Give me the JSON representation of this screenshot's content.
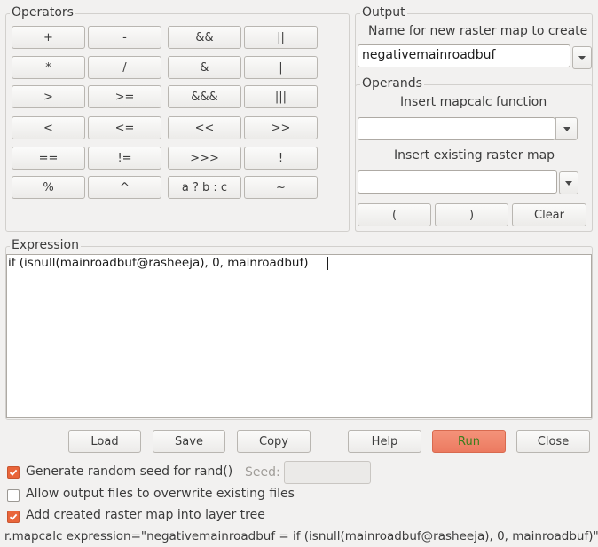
{
  "operators": {
    "title": "Operators",
    "rows": [
      [
        "+",
        "-",
        "&&",
        "||"
      ],
      [
        "*",
        "/",
        "&",
        "|"
      ],
      [
        ">",
        ">=",
        "&&&",
        "|||"
      ],
      [
        "<",
        "<=",
        "<<",
        ">>"
      ],
      [
        "==",
        "!=",
        ">>>",
        "!"
      ],
      [
        "%",
        "^",
        "a ? b : c",
        "~"
      ]
    ]
  },
  "output": {
    "title": "Output",
    "name_label": "Name for new raster map to create",
    "name_value": "negativemainroadbuf"
  },
  "operands": {
    "title": "Operands",
    "function_label": "Insert mapcalc function",
    "function_value": "",
    "raster_label": "Insert existing raster map",
    "raster_value": "",
    "open_paren": "(",
    "close_paren": ")",
    "clear_label": "Clear"
  },
  "expression": {
    "title": "Expression",
    "text": "if (isnull(mainroadbuf@rasheeja), 0, mainroadbuf)"
  },
  "actions": {
    "load": "Load",
    "save": "Save",
    "copy": "Copy",
    "help": "Help",
    "run": "Run",
    "close": "Close"
  },
  "options": {
    "random_seed": {
      "label": "Generate random seed for rand()",
      "checked": true
    },
    "seed_label": "Seed:",
    "seed_value": "",
    "overwrite": {
      "label": "Allow output files to overwrite existing files",
      "checked": false
    },
    "add_layer": {
      "label": "Add created raster map into layer tree",
      "checked": true
    }
  },
  "status": {
    "command": "r.mapcalc expression=\"negativemainroadbuf = if (isnull(mainroadbuf@rasheeja), 0, mainroadbuf)\""
  }
}
